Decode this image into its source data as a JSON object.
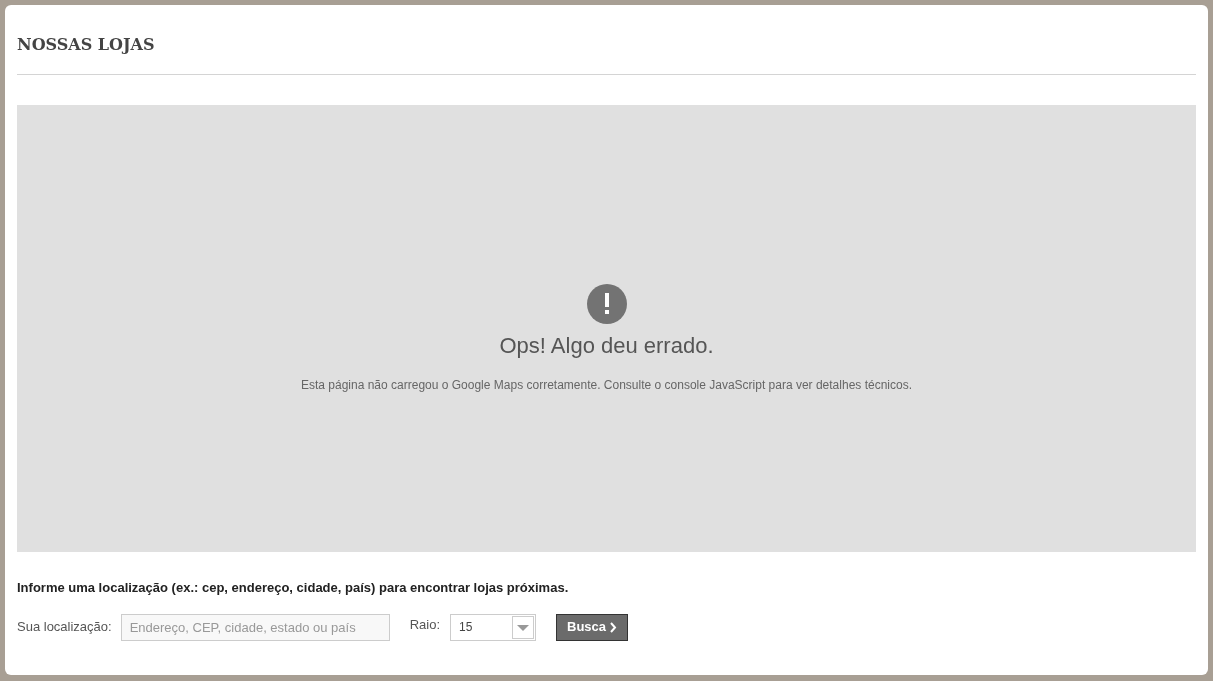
{
  "page_title": "NOSSAS LOJAS",
  "map_error": {
    "title": "Ops! Algo deu errado.",
    "message": "Esta página não carregou o Google Maps corretamente. Consulte o console JavaScript para ver detalhes técnicos."
  },
  "instructions": "Informe uma localização (ex.: cep, endereço, cidade, país) para encontrar lojas próximas.",
  "location_field": {
    "label": "Sua localização:",
    "placeholder": "Endereço, CEP, cidade, estado ou país"
  },
  "radius_select": {
    "label": "Raio:",
    "value": "15"
  },
  "search_button": {
    "label": "Busca"
  }
}
